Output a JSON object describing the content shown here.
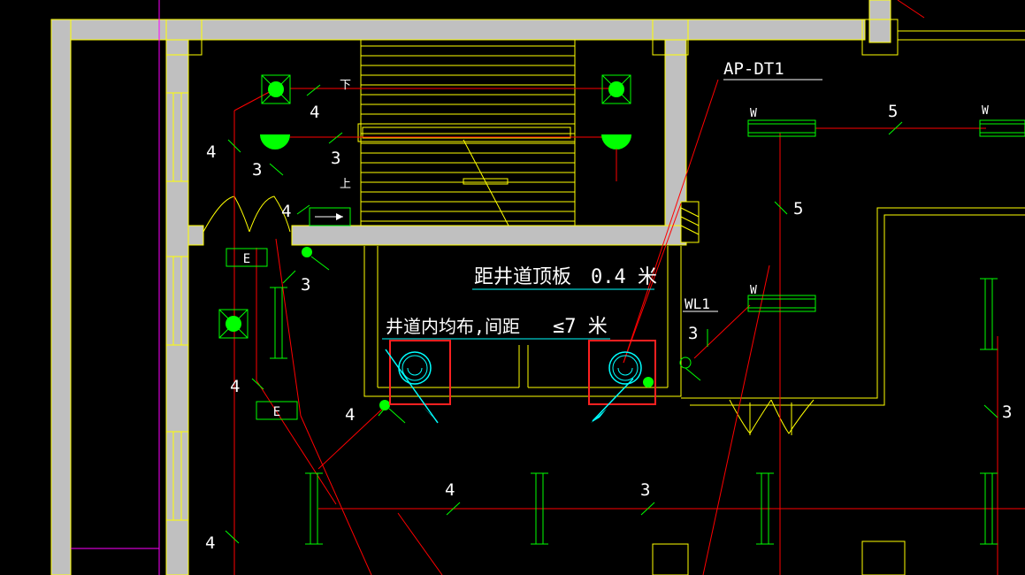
{
  "colors": {
    "background": "#000000",
    "wall_fill": "#c0c0c0",
    "wall_edge": "#ffff00",
    "wire": "#ff0000",
    "device": "#00ff00",
    "text": "#ffffff",
    "leader": "#00ffff",
    "highlight": "#ff2020",
    "magenta": "#ff00ff"
  },
  "labels": {
    "panel_ap": "AP-DT1",
    "panel_wl": "WL1",
    "shaft_top_distance_text": "距井道顶板",
    "shaft_top_distance_value": "0.4 米",
    "shaft_spacing_text": "井道内均布,间距",
    "shaft_spacing_value": "≤7 米",
    "stair_down": "下",
    "stair_up": "上",
    "exit_sign_1": "E",
    "exit_sign_2": "E",
    "w_1": "W",
    "w_2": "W",
    "w_3": "W"
  },
  "wire_counts": [
    {
      "id": "n1",
      "text": "4"
    },
    {
      "id": "n2",
      "text": "4"
    },
    {
      "id": "n3",
      "text": "3"
    },
    {
      "id": "n4",
      "text": "3"
    },
    {
      "id": "n5",
      "text": "4"
    },
    {
      "id": "n6",
      "text": "3"
    },
    {
      "id": "n7",
      "text": "4"
    },
    {
      "id": "n8",
      "text": "4"
    },
    {
      "id": "n9",
      "text": "4"
    },
    {
      "id": "n10",
      "text": "4"
    },
    {
      "id": "n11",
      "text": "3"
    },
    {
      "id": "n12",
      "text": "5"
    },
    {
      "id": "n13",
      "text": "5"
    },
    {
      "id": "n14",
      "text": "3"
    },
    {
      "id": "n15",
      "text": "3"
    }
  ]
}
